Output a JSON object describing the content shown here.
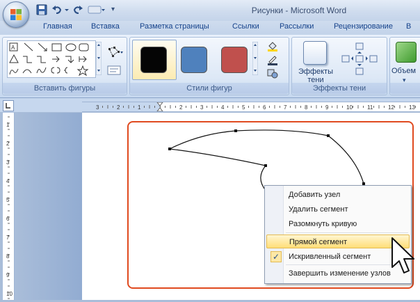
{
  "window": {
    "title": "Рисунки - Microsoft Word"
  },
  "qat": {
    "save_icon": "save-icon",
    "undo_icon": "undo-icon",
    "redo_icon": "redo-icon",
    "customize_icon": "customize-qat-icon",
    "more_label": "▾"
  },
  "tabs": [
    "Главная",
    "Вставка",
    "Разметка страницы",
    "Ссылки",
    "Рассылки",
    "Рецензирование",
    "В"
  ],
  "ribbon": {
    "insert_shapes_group": "Вставить фигуры",
    "shape_styles_group": "Стили фигур",
    "shadow_effects_group": "Эффекты тени",
    "shadow_effects_button": "Эффекты тени",
    "volume_button": "Объем",
    "swatch_colors": [
      "#050505",
      "#4f81bd",
      "#c0504d"
    ]
  },
  "context_menu": {
    "items": [
      {
        "label": "Добавить узел",
        "highlighted": false,
        "checked": false
      },
      {
        "label": "Удалить сегмент",
        "highlighted": false,
        "checked": false
      },
      {
        "label": "Разомкнуть кривую",
        "highlighted": false,
        "checked": false
      },
      {
        "label": "Прямой сегмент",
        "highlighted": true,
        "checked": false
      },
      {
        "label": "Искривленный сегмент",
        "highlighted": false,
        "checked": true
      },
      {
        "label": "Завершить изменение узлов",
        "highlighted": false,
        "checked": false
      }
    ]
  },
  "ruler": {
    "h_numbers": [
      "3",
      "2",
      "1",
      "1",
      "2",
      "3",
      "4",
      "5",
      "6",
      "7",
      "8",
      "9",
      "10",
      "11",
      "12",
      "13"
    ],
    "v_numbers": [
      "1",
      "2",
      "3",
      "4",
      "5",
      "6",
      "7",
      "8",
      "9",
      "10"
    ]
  },
  "colors": {
    "frame": "#e04a1f",
    "menu_highlight": "#ffde78"
  }
}
